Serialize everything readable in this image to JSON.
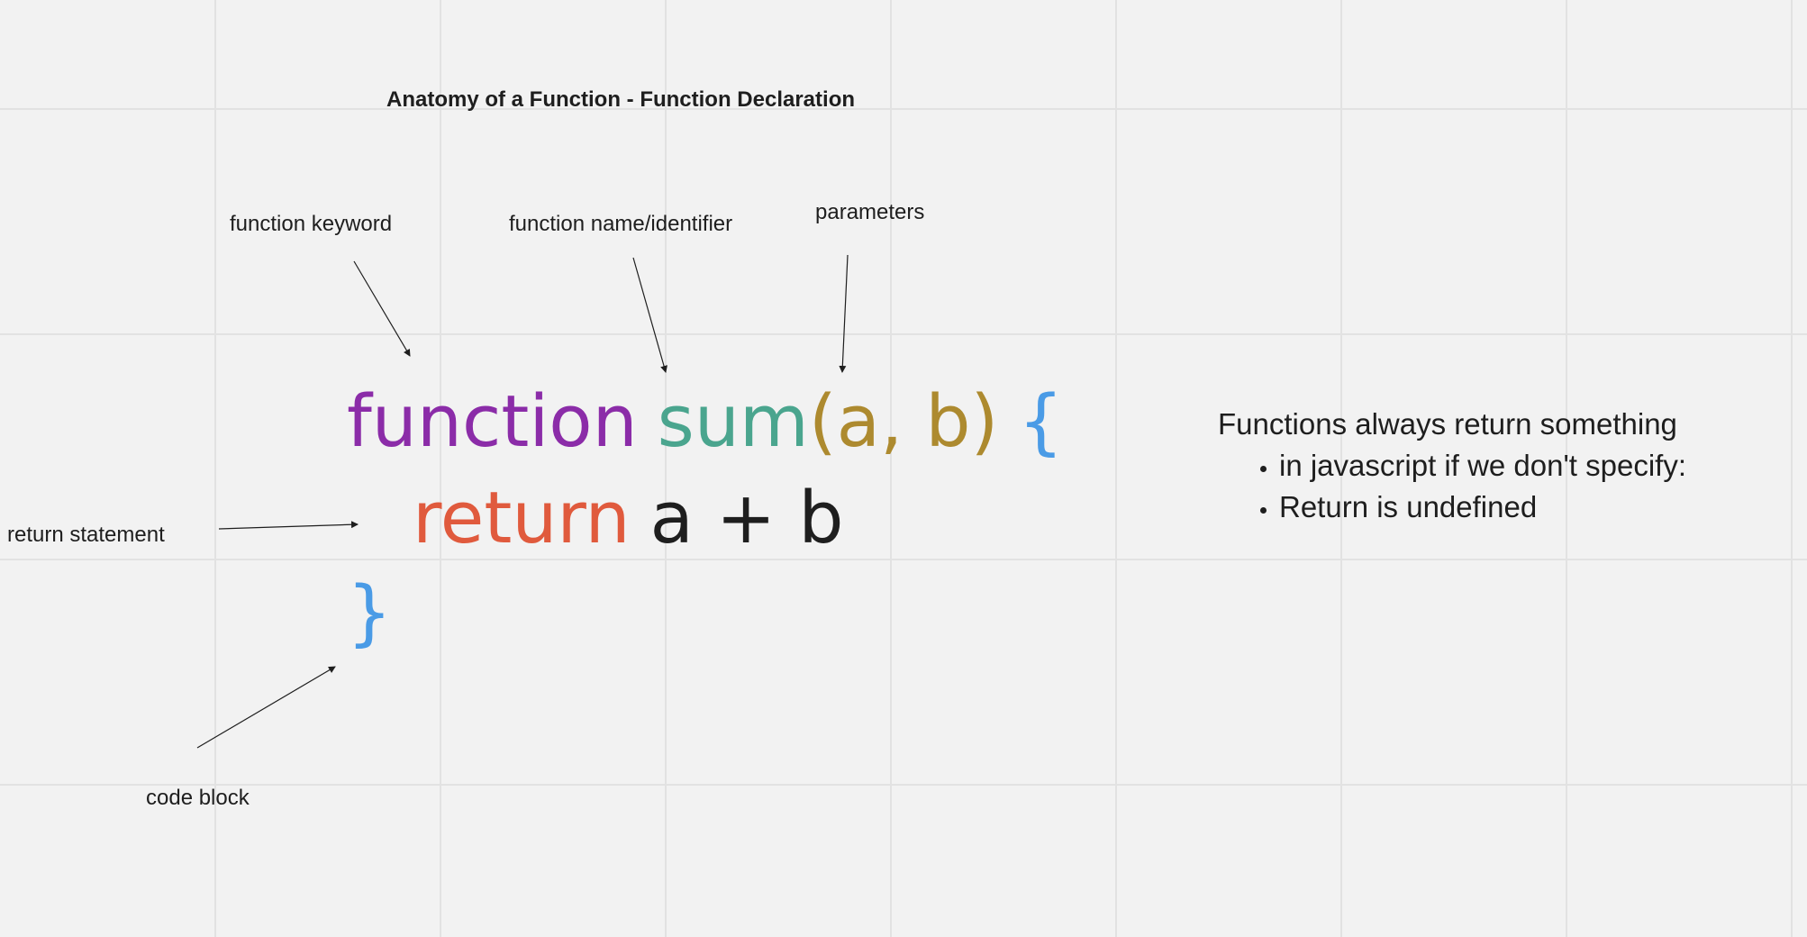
{
  "title": "Anatomy of a Function - Function Declaration",
  "labels": {
    "function_keyword": "function keyword",
    "function_name": "function name/identifier",
    "parameters": "parameters",
    "return_statement": "return statement",
    "code_block": "code block"
  },
  "code": {
    "keyword": "function",
    "name": "sum",
    "params": "(a, b)",
    "open_brace": "{",
    "return_keyword": "return",
    "return_expression": "a + b",
    "close_brace": "}"
  },
  "colors": {
    "keyword": "#8b2ca8",
    "name": "#4aa58e",
    "params": "#ad8a2f",
    "brace": "#4a9be6",
    "return_keyword": "#e05a3d",
    "expression": "#1e1e1e",
    "background": "#f2f2f2",
    "grid": "#e2e2e2"
  },
  "note": {
    "heading": "Functions always return something",
    "bullets": [
      "in javascript if we don't specify:",
      "Return is undefined"
    ]
  }
}
